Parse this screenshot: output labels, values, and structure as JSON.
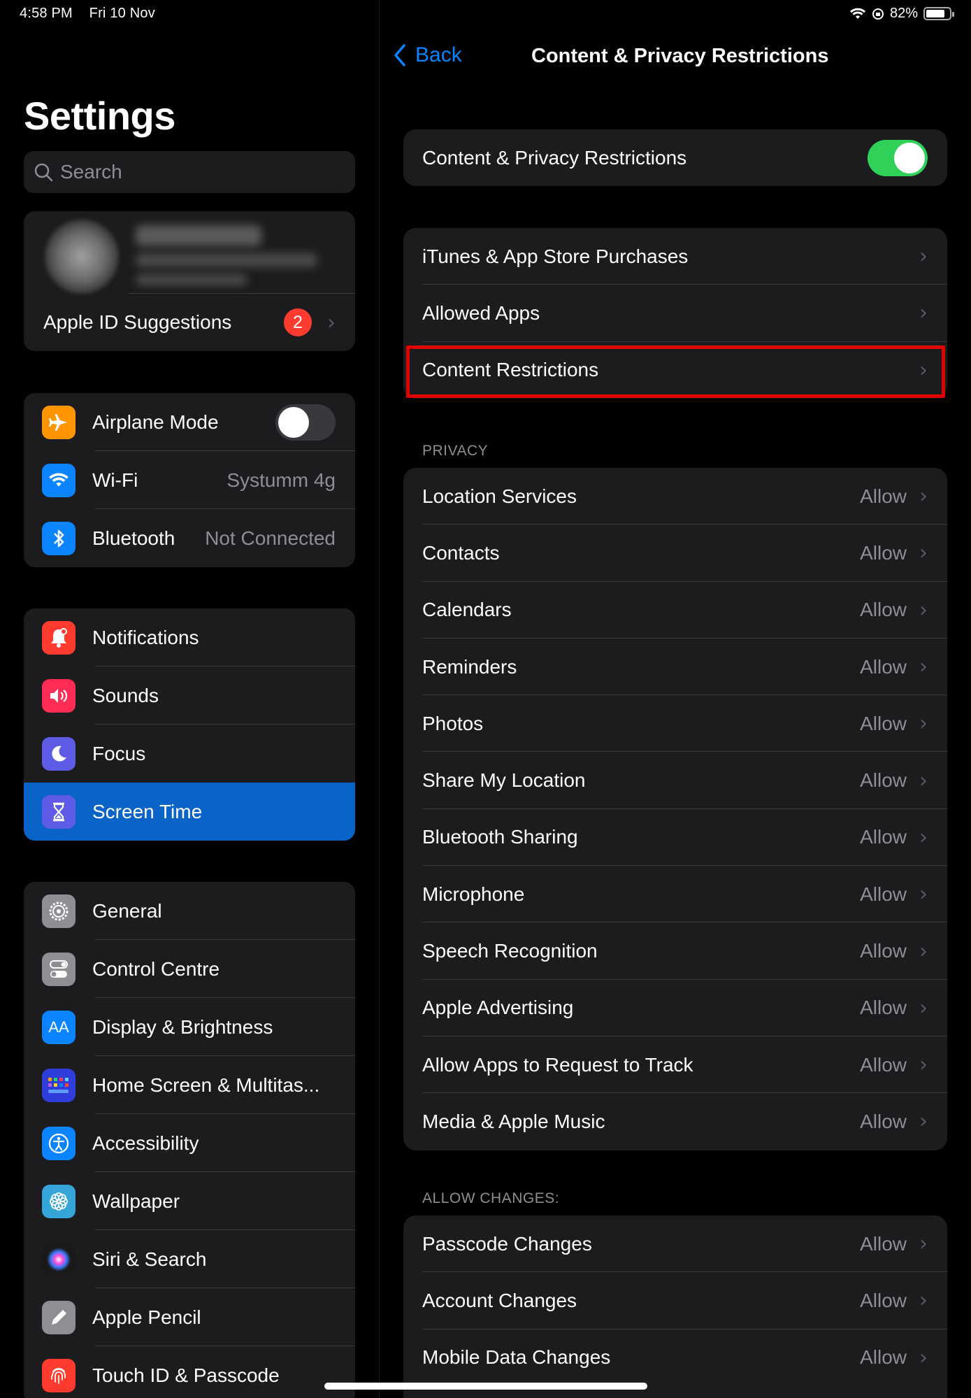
{
  "status_bar": {
    "time": "4:58 PM",
    "date": "Fri 10 Nov",
    "battery": "82%"
  },
  "sidebar": {
    "title": "Settings",
    "search_placeholder": "Search",
    "apple_id": {
      "suggestions_label": "Apple ID Suggestions",
      "badge_count": "2"
    },
    "connectivity": [
      {
        "label": "Airplane Mode",
        "icon": "airplane-icon",
        "toggle": false,
        "color": "#ff9500"
      },
      {
        "label": "Wi-Fi",
        "icon": "wifi-icon",
        "value": "Systumm 4g",
        "color": "#0a84ff"
      },
      {
        "label": "Bluetooth",
        "icon": "bluetooth-icon",
        "value": "Not Connected",
        "color": "#0a84ff"
      }
    ],
    "notifications_group": [
      {
        "label": "Notifications",
        "icon": "bell-icon",
        "color": "#ff3b30"
      },
      {
        "label": "Sounds",
        "icon": "speaker-icon",
        "color": "#ff2d55"
      },
      {
        "label": "Focus",
        "icon": "moon-icon",
        "color": "#5e5ce6"
      },
      {
        "label": "Screen Time",
        "icon": "hourglass-icon",
        "color": "#5e5ce6",
        "selected": true
      }
    ],
    "general_group": [
      {
        "label": "General",
        "icon": "gear-icon",
        "color": "#8e8e93"
      },
      {
        "label": "Control Centre",
        "icon": "switches-icon",
        "color": "#8e8e93"
      },
      {
        "label": "Display & Brightness",
        "icon": "text-size-icon",
        "color": "#0a84ff"
      },
      {
        "label": "Home Screen & Multitas...",
        "icon": "app-grid-icon",
        "color": "#2f3ddb"
      },
      {
        "label": "Accessibility",
        "icon": "accessibility-icon",
        "color": "#0a84ff"
      },
      {
        "label": "Wallpaper",
        "icon": "flower-icon",
        "color": "#36a6d9"
      },
      {
        "label": "Siri & Search",
        "icon": "siri-icon",
        "color": "#222"
      },
      {
        "label": "Apple Pencil",
        "icon": "pencil-icon",
        "color": "#8e8e93"
      },
      {
        "label": "Touch ID & Passcode",
        "icon": "fingerprint-icon",
        "color": "#ff3b30"
      }
    ]
  },
  "detail": {
    "back_label": "Back",
    "title": "Content & Privacy Restrictions",
    "master_toggle": {
      "label": "Content & Privacy Restrictions",
      "on": true
    },
    "store_group": [
      {
        "label": "iTunes & App Store Purchases"
      },
      {
        "label": "Allowed Apps"
      },
      {
        "label": "Content Restrictions",
        "highlighted": true
      }
    ],
    "privacy_header": "PRIVACY",
    "privacy_items": [
      {
        "label": "Location Services",
        "value": "Allow"
      },
      {
        "label": "Contacts",
        "value": "Allow"
      },
      {
        "label": "Calendars",
        "value": "Allow"
      },
      {
        "label": "Reminders",
        "value": "Allow"
      },
      {
        "label": "Photos",
        "value": "Allow"
      },
      {
        "label": "Share My Location",
        "value": "Allow"
      },
      {
        "label": "Bluetooth Sharing",
        "value": "Allow"
      },
      {
        "label": "Microphone",
        "value": "Allow"
      },
      {
        "label": "Speech Recognition",
        "value": "Allow"
      },
      {
        "label": "Apple Advertising",
        "value": "Allow"
      },
      {
        "label": "Allow Apps to Request to Track",
        "value": "Allow"
      },
      {
        "label": "Media & Apple Music",
        "value": "Allow"
      }
    ],
    "changes_header": "ALLOW CHANGES:",
    "changes_items": [
      {
        "label": "Passcode Changes",
        "value": "Allow"
      },
      {
        "label": "Account Changes",
        "value": "Allow"
      },
      {
        "label": "Mobile Data Changes",
        "value": "Allow"
      }
    ]
  },
  "colors": {
    "accent": "#0a84ff",
    "toggle_on": "#30d158",
    "highlight_border": "#e00000",
    "selected_row": "#0a64c8"
  }
}
